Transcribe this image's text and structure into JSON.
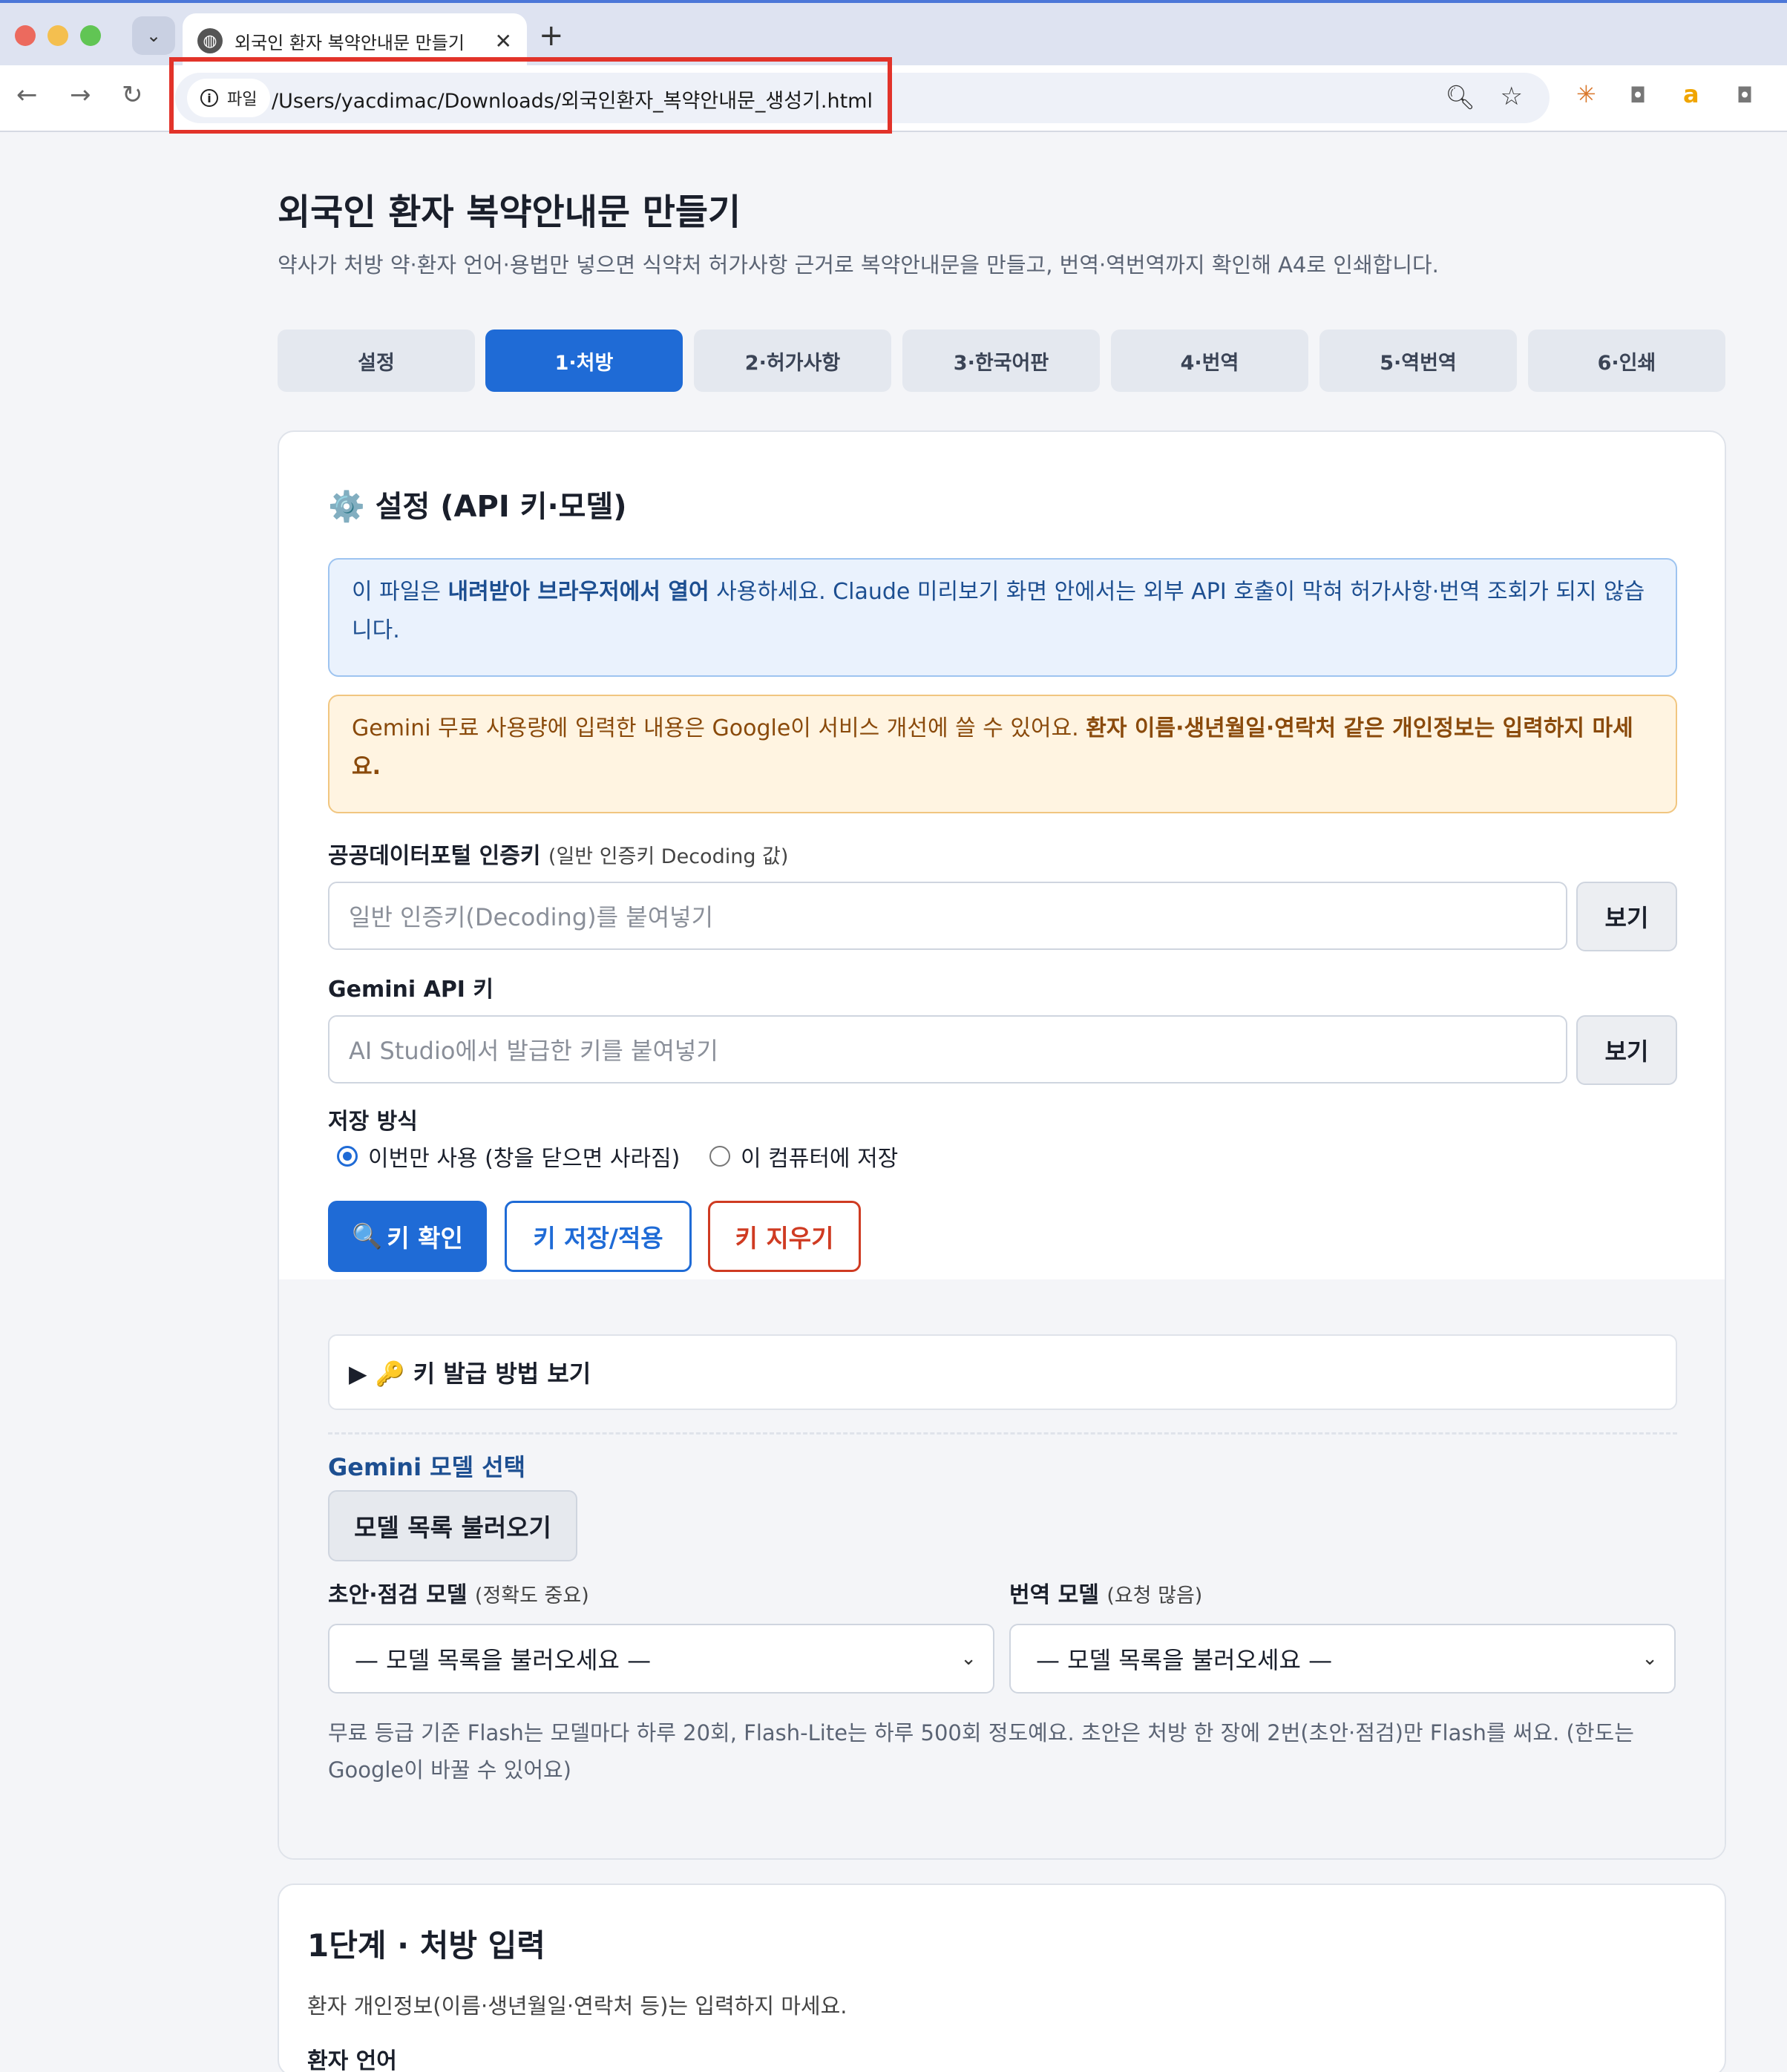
{
  "browser": {
    "tab_title": "외국인 환자 복약안내문 만들기",
    "tab_close": "✕",
    "new_tab": "+",
    "file_label": "파일",
    "url": "/Users/yacdimac/Downloads/외국인환자_복약안내문_생성기.html",
    "colors": {
      "traffic_red": "#ec6a5e",
      "traffic_yellow": "#f4bf4f",
      "traffic_green": "#61c554",
      "highlight": "#e2332a"
    }
  },
  "header": {
    "title": "외국인 환자 복약안내문 만들기",
    "subtitle": "약사가 처방 약·환자 언어·용법만 넣으면 식약처 허가사항 근거로 복약안내문을 만들고, 번역·역번역까지 확인해 A4로 인쇄합니다."
  },
  "steps": [
    {
      "label": "설정",
      "active": false
    },
    {
      "label": "1·처방",
      "active": true
    },
    {
      "label": "2·허가사항",
      "active": false
    },
    {
      "label": "3·한국어판",
      "active": false
    },
    {
      "label": "4·번역",
      "active": false
    },
    {
      "label": "5·역번역",
      "active": false
    },
    {
      "label": "6·인쇄",
      "active": false
    }
  ],
  "settings": {
    "icon": "⚙️",
    "title": "설정 (API 키·모델)",
    "notice_info": {
      "pre": "이 파일은 ",
      "bold": "내려받아 브라우저에서 열어",
      "post": " 사용하세요. Claude 미리보기 화면 안에서는 외부 API 호출이 막혀 허가사항·번역 조회가 되지 않습니다."
    },
    "notice_warning": {
      "pre": "Gemini 무료 사용량에 입력한 내용은 Google이 서비스 개선에 쓸 수 있어요. ",
      "bold": "환자 이름·생년월일·연락처 같은 개인정보는 입력하지 마세요."
    },
    "public_key": {
      "label": "공공데이터포털 인증키",
      "hint": "(일반 인증키 Decoding 값)",
      "placeholder": "일반 인증키(Decoding)를 붙여넣기",
      "value": "",
      "show_button": "보기"
    },
    "gemini_key": {
      "label": "Gemini API 키",
      "placeholder": "AI Studio에서 발급한 키를 붙여넣기",
      "value": "",
      "show_button": "보기"
    },
    "storage": {
      "label": "저장 방식",
      "options": [
        {
          "label": "이번만 사용 (창을 닫으면 사라짐)",
          "checked": true
        },
        {
          "label": "이 컴퓨터에 저장",
          "checked": false
        }
      ]
    },
    "buttons": {
      "check_icon": "🔍",
      "check": "키 확인",
      "save": "키 저장/적용",
      "clear": "키 지우기"
    },
    "details_summary": "▶ 🔑 키 발급 방법 보기",
    "model": {
      "heading": "Gemini 모델 선택",
      "load_button": "모델 목록 불러오기",
      "draft_label": "초안·점검 모델",
      "draft_hint": "(정확도 중요)",
      "draft_value": "— 모델 목록을 불러오세요 —",
      "translate_label": "번역 모델",
      "translate_hint": "(요청 많음)",
      "translate_value": "— 모델 목록을 불러오세요 —",
      "quota_note": "무료 등급 기준 Flash는 모델마다 하루 20회, Flash-Lite는 하루 500회 정도예요. 초안은 처방 한 장에 2번(초안·점검)만 Flash를 써요. (한도는 Google이 바꿀 수 있어요)"
    }
  },
  "step1": {
    "title": "1단계 · 처방 입력",
    "note": "환자 개인정보(이름·생년월일·연락처 등)는 입력하지 마세요.",
    "language_label": "환자 언어"
  },
  "accent_color": "#1f6bd6"
}
